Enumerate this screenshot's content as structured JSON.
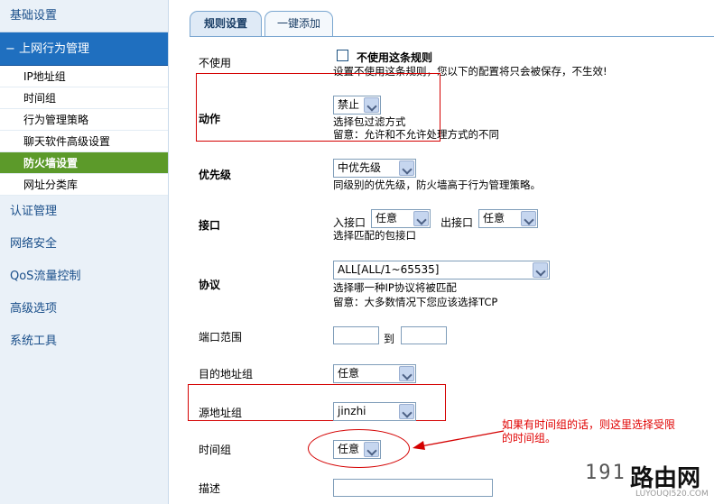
{
  "sidebar": {
    "top": "基础设置",
    "active": "上网行为管理",
    "subitems": [
      "IP地址组",
      "时间组",
      "行为管理策略",
      "聊天软件高级设置",
      "防火墙设置",
      "网址分类库"
    ],
    "groups": [
      "认证管理",
      "网络安全",
      "QoS流量控制",
      "高级选项",
      "系统工具"
    ]
  },
  "tabs": {
    "active": "规则设置",
    "inactive": "一键添加"
  },
  "form": {
    "disable_label": "不使用",
    "disable_checkbox": "不使用这条规则",
    "disable_hint": "设置不使用这条规则，您以下的配置将只会被保存，不生效!",
    "action_label": "动作",
    "action_value": "禁止",
    "action_hint1": "选择包过滤方式",
    "action_hint2": "留意：允许和不允许处理方式的不同",
    "priority_label": "优先级",
    "priority_value": "中优先级",
    "priority_hint": "同级别的优先级，防火墙高于行为管理策略。",
    "iface_label": "接口",
    "in_label": "入接口",
    "in_value": "任意",
    "out_label": "出接口",
    "out_value": "任意",
    "iface_hint": "选择匹配的包接口",
    "proto_label": "协议",
    "proto_value": "ALL[ALL/1~65535]",
    "proto_hint1": "选择哪一种IP协议将被匹配",
    "proto_hint2": "留意：大多数情况下您应该选择TCP",
    "port_label": "端口范围",
    "port_to": "到",
    "dst_label": "目的地址组",
    "dst_value": "任意",
    "src_label": "源地址组",
    "src_value": "jinzhi",
    "time_label": "时间组",
    "time_value": "任意",
    "desc_label": "描述"
  },
  "annotation": {
    "line1": "如果有时间组的话，则这里选择受限",
    "line2": "的时间组。"
  },
  "watermark": {
    "num": "191",
    "cn": "路由网",
    "url": "LUYOUQI520.COM"
  },
  "colors": {
    "annotation_red": "#d40000",
    "active_nav": "#1f6fbf",
    "active_sub": "#5c9a2a"
  }
}
